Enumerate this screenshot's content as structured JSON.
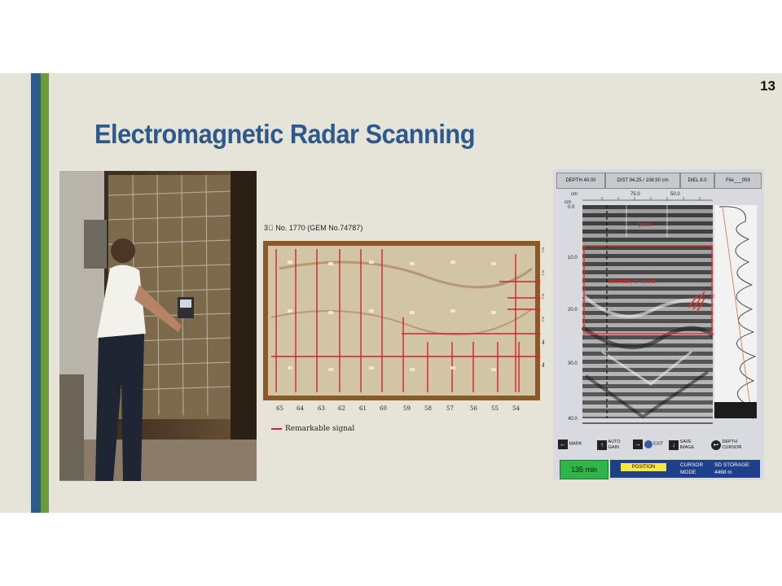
{
  "slide": {
    "page_number": "13",
    "title": "Electromagnetic Radar Scanning"
  },
  "wall_map": {
    "caption": "3\u0000 No. 1770 (GEM No.74787)",
    "column_labels": [
      "65",
      "64",
      "63",
      "62",
      "61",
      "60",
      "59",
      "58",
      "57",
      "56",
      "55",
      "54"
    ],
    "row_labels": [
      "53",
      "52",
      "51",
      "50",
      "49",
      "48"
    ],
    "legend_label": "Remarkable signal",
    "signal_color": "#d2222a"
  },
  "radar": {
    "header": {
      "depth": "DEPTH 40.00",
      "dist": "DIST 94.25 / 108.50 cm",
      "diel": "DIEL 8.0",
      "file": "File___059"
    },
    "top_axis": {
      "unit": "cm",
      "ticks": [
        "75.0",
        "50.0"
      ]
    },
    "left_axis": {
      "unit": "cm",
      "ticks": [
        "0.0",
        "10.0",
        "20.0",
        "30.0",
        "40.0"
      ]
    },
    "annotations": {
      "glass": "glass",
      "boundary": "Boundary of bricks",
      "object": "object"
    },
    "buttons": [
      {
        "label": "MARK"
      },
      {
        "label": "AUTO\nGAIN"
      },
      {
        "label": "EXIT"
      },
      {
        "label": "SAVE\nIMAGE"
      },
      {
        "label": "DEPTH\nCURSOR"
      }
    ],
    "status": {
      "time": "135 min",
      "position": "POSITION",
      "cursor_mode": "CURSOR\nMODE",
      "storage": "SD STORAGE:\n4468 m"
    }
  },
  "colors": {
    "title": "#2d5a8c",
    "bar_blue": "#2e5c8a",
    "bar_green": "#6f9a3c",
    "annotation_red": "#e0302a"
  }
}
